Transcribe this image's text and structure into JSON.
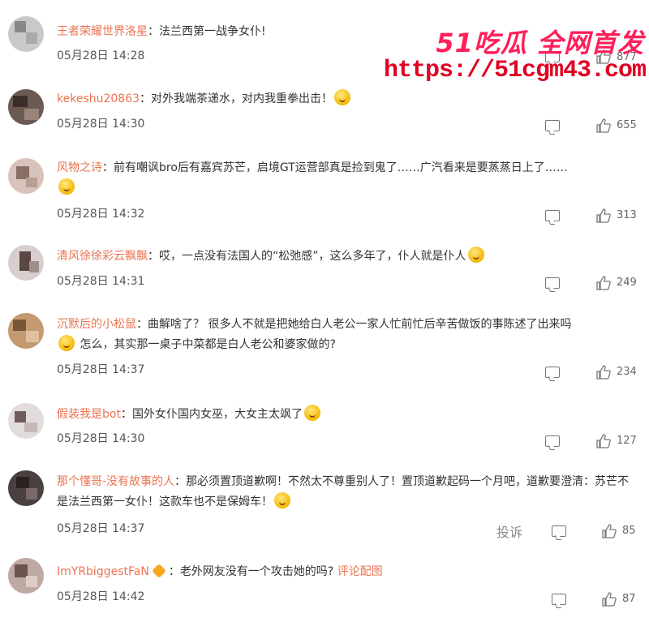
{
  "watermark": {
    "line1": "51吃瓜 全网首发",
    "line2": "https://51cgm43.com"
  },
  "report_label": "投诉",
  "comments": [
    {
      "user": "王者荣耀世界洛星",
      "sep": "：",
      "text": "法兰西第一战争女仆!",
      "time": "05月28日 14:28",
      "likes": "877"
    },
    {
      "user": "kekeshu20863",
      "sep": "：",
      "text": "对外我端茶递水，对内我重拳出击！",
      "time": "05月28日 14:30",
      "likes": "655"
    },
    {
      "user": "风物之诗",
      "sep": "：",
      "text": "前有嘲讽bro后有嘉宾苏芒，启境GT运营部真是捡到鬼了……广汽看来是要蒸蒸日上了……",
      "time": "05月28日 14:32",
      "likes": "313"
    },
    {
      "user": "清风徐徐彩云飘飘",
      "sep": "：",
      "text": "哎，一点没有法国人的“松弛感”，这么多年了，仆人就是仆人",
      "time": "05月28日 14:31",
      "likes": "249"
    },
    {
      "user": "沉默后的小松鼠",
      "sep": "：",
      "text": "曲解啥了？ 很多人不就是把她给白人老公一家人忙前忙后辛苦做饭的事陈述了出来吗",
      "text2": "怎么，其实那一桌子中菜都是白人老公和婆家做的?",
      "time": "05月28日 14:37",
      "likes": "234"
    },
    {
      "user": "假装我是bot",
      "sep": "：",
      "text": "国外女仆国内女巫，大女主太飒了",
      "time": "05月28日 14:30",
      "likes": "127"
    },
    {
      "user": "那个懂哥-没有故事的人",
      "sep": "：",
      "text": "那必须置顶道歉啊！不然太不尊重别人了！置顶道歉起码一个月吧，道歉要澄清：苏芒不是法兰西第一女仆！这款车也不是保姆车！",
      "time": "05月28日 14:37",
      "likes": "85"
    },
    {
      "user": "ImYRbiggestFaN",
      "sep": "：",
      "text": "老外网友没有一个攻击她的吗?",
      "link": "评论配图",
      "time": "05月28日 14:42",
      "likes": "87"
    }
  ]
}
